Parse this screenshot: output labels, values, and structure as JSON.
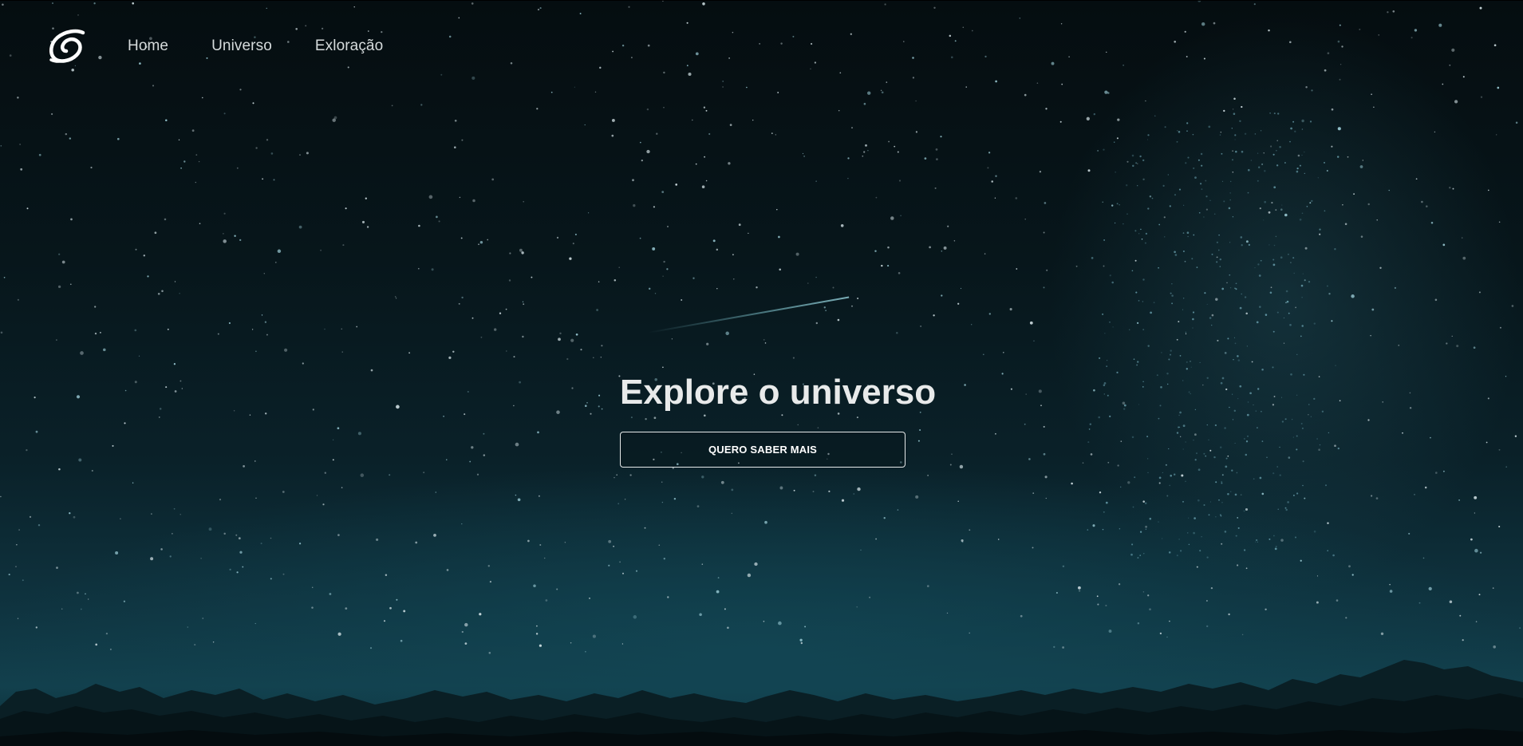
{
  "nav": {
    "logo_icon": "spiral-galaxy-logo-icon",
    "items": [
      {
        "label": "Home"
      },
      {
        "label": "Universo"
      },
      {
        "label": "Exloração"
      }
    ]
  },
  "hero": {
    "headline": "Explore o universo",
    "cta_label": "QUERO SABER MAIS",
    "background": "starry night sky over mountain silhouettes"
  },
  "colors": {
    "sky_top": "#050d10",
    "sky_horizon": "#12404d",
    "text_primary": "#e8eaea",
    "nav_text": "#d6dbdc",
    "button_border": "#e6e9e9"
  }
}
